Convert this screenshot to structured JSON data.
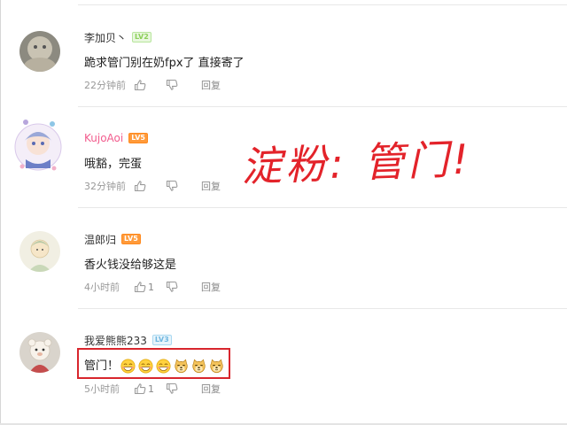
{
  "overlay_caption": "淀粉:  管门!",
  "comments": [
    {
      "username": "李加贝丶",
      "level": "LV2",
      "text": "跪求管门别在奶fpx了  直接寄了",
      "time": "22分钟前",
      "like_count": "",
      "reply_label": "回复"
    },
    {
      "username": "KujoAoi",
      "level": "LV5",
      "text": "哦豁，完蛋",
      "time": "32分钟前",
      "like_count": "",
      "reply_label": "回复"
    },
    {
      "username": "温郎归",
      "level": "LV5",
      "text": "香火钱没给够这是",
      "time": "4小时前",
      "like_count": "1",
      "reply_label": "回复"
    },
    {
      "username": "我爱熊熊233",
      "level": "LV3",
      "text": "管门！",
      "emojis": [
        "grin-face-emoji",
        "grin-face-emoji",
        "grin-face-emoji",
        "doge-emoji",
        "doge-emoji",
        "doge-emoji"
      ],
      "time": "5小时前",
      "like_count": "1",
      "reply_label": "回复"
    }
  ],
  "colors": {
    "vip_name": "#f25d8e",
    "highlight": "#d8262d",
    "caption": "#e3232a",
    "meta_text": "#999999"
  }
}
